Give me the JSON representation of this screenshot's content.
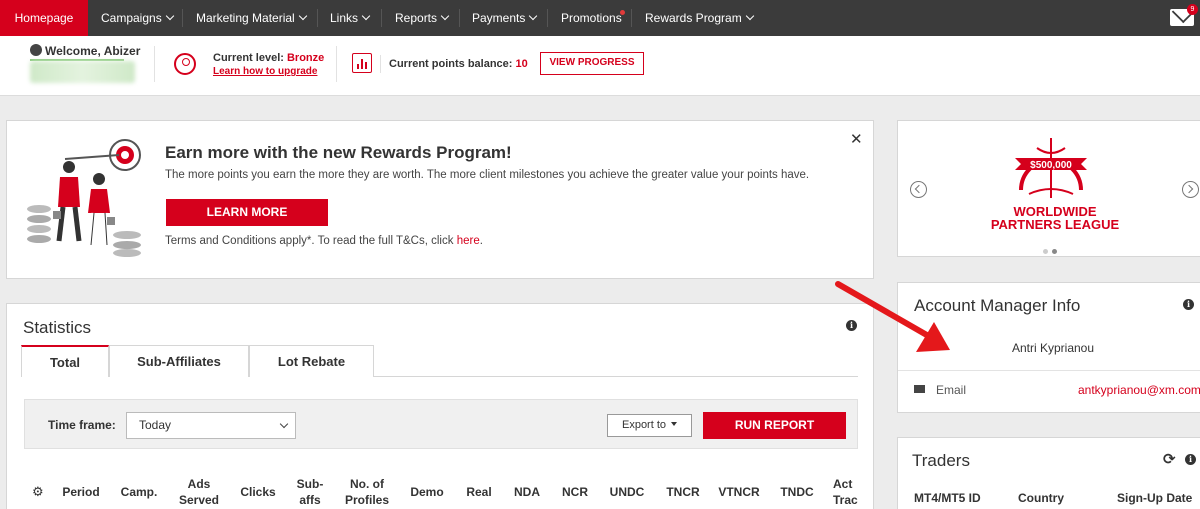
{
  "nav": {
    "items": [
      {
        "label": "Homepage"
      },
      {
        "label": "Campaigns"
      },
      {
        "label": "Marketing Material"
      },
      {
        "label": "Links"
      },
      {
        "label": "Reports"
      },
      {
        "label": "Payments"
      },
      {
        "label": "Promotions"
      },
      {
        "label": "Rewards Program"
      }
    ],
    "mail_badge": "9"
  },
  "user": {
    "welcome": "Welcome, Abizer",
    "level_prefix": "Current level:",
    "level_value": "Bronze",
    "upgrade_link": "Learn how to upgrade",
    "points_prefix": "Current points balance:",
    "points_value": "10",
    "view_progress": "VIEW PROGRESS"
  },
  "rewards": {
    "title": "Earn more with the new Rewards Program!",
    "desc": "The more points you earn the more they are worth. The more client milestones you achieve the greater value your points have.",
    "learn_more": "LEARN MORE",
    "terms_text": "Terms and Conditions apply*. To read the full T&Cs, click",
    "terms_link": "here",
    "terms_end": "."
  },
  "league": {
    "amount": "$500,000",
    "line1": "WORLDWIDE",
    "line2": "PARTNERS LEAGUE"
  },
  "manager": {
    "title": "Account Manager Info",
    "name": "Antri Kyprianou",
    "email_label": "Email",
    "email_value": "antkyprianou@xm.com"
  },
  "traders": {
    "title": "Traders",
    "columns": [
      "MT4/MT5 ID",
      "Country",
      "Sign-Up Date"
    ]
  },
  "stats": {
    "title": "Statistics",
    "tabs": [
      "Total",
      "Sub-Affiliates",
      "Lot Rebate"
    ],
    "timeframe_label": "Time frame:",
    "timeframe_value": "Today",
    "export_label": "Export to",
    "run_report": "RUN REPORT",
    "columns": [
      {
        "l1": "Period",
        "l2": ""
      },
      {
        "l1": "Camp.",
        "l2": ""
      },
      {
        "l1": "Ads",
        "l2": "Served"
      },
      {
        "l1": "Clicks",
        "l2": ""
      },
      {
        "l1": "Sub-",
        "l2": "affs"
      },
      {
        "l1": "No. of",
        "l2": "Profiles"
      },
      {
        "l1": "Demo",
        "l2": ""
      },
      {
        "l1": "Real",
        "l2": ""
      },
      {
        "l1": "NDA",
        "l2": ""
      },
      {
        "l1": "NCR",
        "l2": ""
      },
      {
        "l1": "UNDC",
        "l2": ""
      },
      {
        "l1": "TNCR",
        "l2": ""
      },
      {
        "l1": "VTNCR",
        "l2": ""
      },
      {
        "l1": "TNDC",
        "l2": ""
      },
      {
        "l1": "Act",
        "l2": "Trac"
      }
    ]
  },
  "colors": {
    "accent": "#d5001c",
    "nav_bg": "#3b3b3b"
  }
}
